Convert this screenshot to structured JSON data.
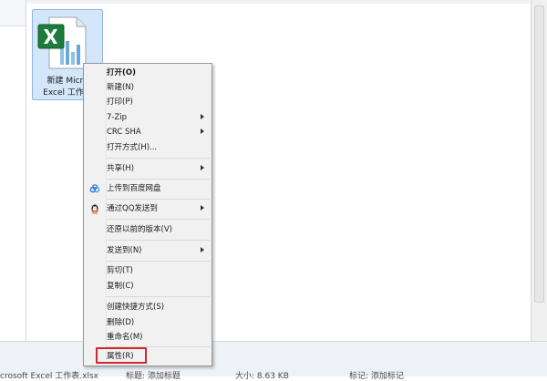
{
  "file": {
    "name_line1": "新建 Micro",
    "name_line2": "Excel 工作表"
  },
  "status_bar": {
    "file_name": "crosoft Excel 工作表.xlsx",
    "title_label": "标题: 添加标题",
    "size_label": "大小: 8.63 KB",
    "tags_label": "标记: 添加标记"
  },
  "context_menu": {
    "items": [
      {
        "label": "打开(O)"
      },
      {
        "label": "新建(N)"
      },
      {
        "label": "打印(P)"
      },
      {
        "label": "7-Zip"
      },
      {
        "label": "CRC SHA"
      },
      {
        "label": "打开方式(H)..."
      },
      {
        "label": "共享(H)"
      },
      {
        "label": "上传到百度网盘"
      },
      {
        "label": "通过QQ发送到"
      },
      {
        "label": "还原以前的版本(V)"
      },
      {
        "label": "发送到(N)"
      },
      {
        "label": "剪切(T)"
      },
      {
        "label": "复制(C)"
      },
      {
        "label": "创建快捷方式(S)"
      },
      {
        "label": "删除(D)"
      },
      {
        "label": "重命名(M)"
      },
      {
        "label": "属性(R)"
      }
    ]
  },
  "colors": {
    "highlight": "#d0282c",
    "selection": "#d4e6f9",
    "excel_green": "#1e7b3c"
  },
  "icons": [
    "excel-file-icon",
    "baidu-netdisk-icon",
    "qq-penguin-icon",
    "submenu-arrow-icon"
  ]
}
